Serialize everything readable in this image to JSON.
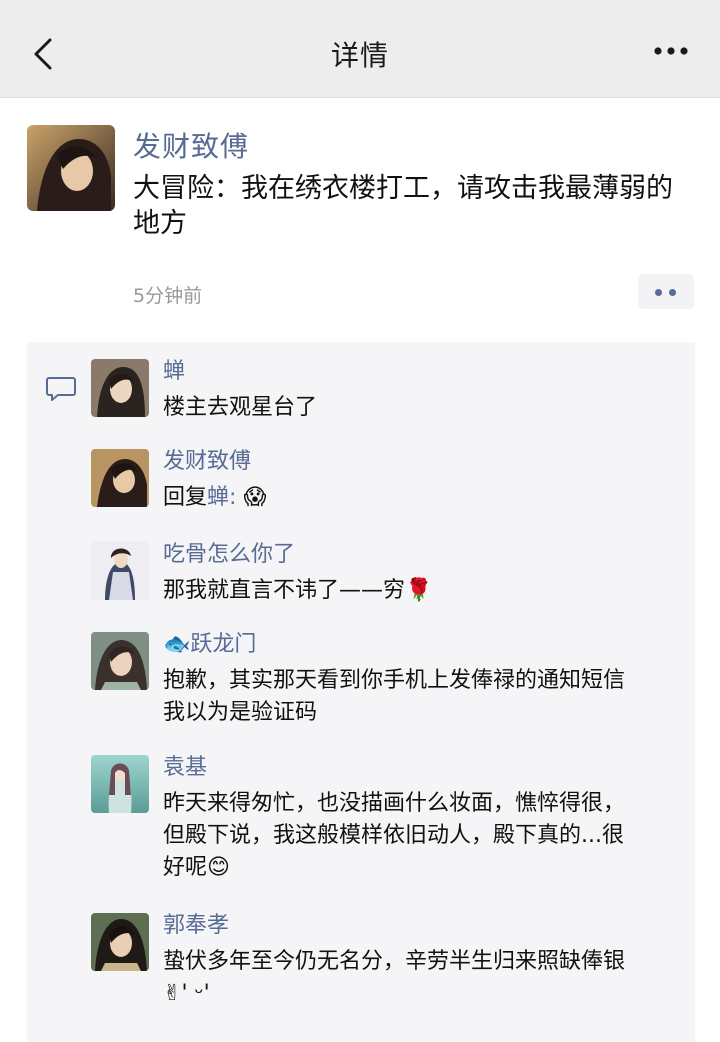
{
  "header": {
    "title": "详情",
    "back_icon": "chevron-left-icon",
    "more_icon": "more-horizontal-icon"
  },
  "post": {
    "author": "发财致傅",
    "text": "大冒险：我在绣衣楼打工，请攻击我最薄弱的地方",
    "time": "5分钟前"
  },
  "comments": [
    {
      "name": "蝉",
      "text": "楼主去观星台了"
    },
    {
      "name": "发财致傅",
      "reply_prefix": "回复",
      "reply_to": "蝉",
      "reply_sep": ":",
      "emoji": "😱"
    },
    {
      "name": "吃骨怎么你了",
      "text": "那我就直言不讳了——穷",
      "emoji": "🌹"
    },
    {
      "name_emoji": "🐟",
      "name": "跃龙门",
      "text": "抱歉，其实那天看到你手机上发俸禄的通知短信我以为是验证码"
    },
    {
      "name": "袁基",
      "text": "昨天来得匆忙，也没描画什么妆面，憔悴得很，但殿下说，我这般模样依旧动人，殿下真的...很好呢",
      "emoji": "😊"
    },
    {
      "name": "郭奉孝",
      "text": "蛰伏多年至今仍无名分，辛劳半生归来照缺俸银",
      "emoji": "✌",
      "suffix": "' ᵕ'"
    }
  ],
  "colors": {
    "link": "#576b95",
    "nav_bg": "#ededed",
    "comment_bg": "#f5f5f7"
  }
}
